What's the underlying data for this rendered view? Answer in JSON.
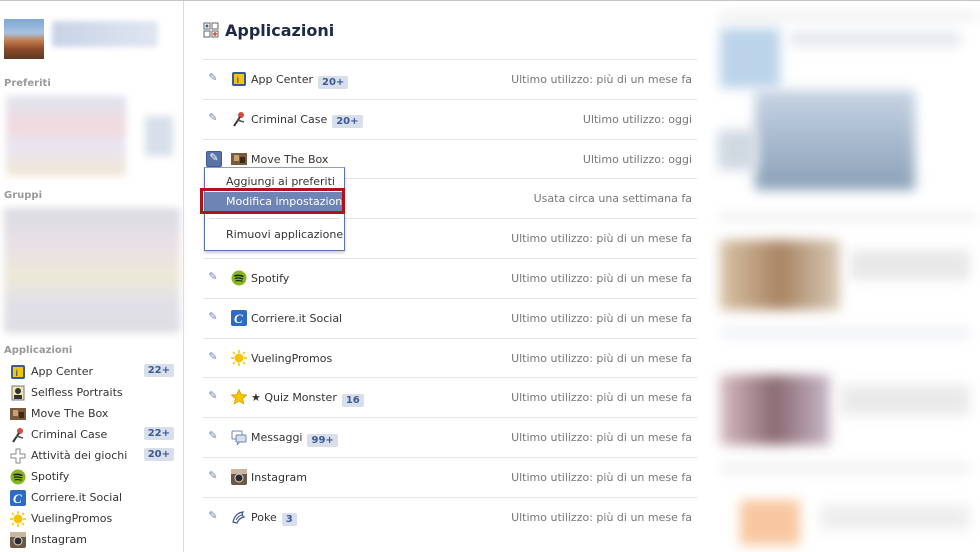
{
  "header": {
    "title": "Applicazioni"
  },
  "sidebar": {
    "sections": {
      "favorites": "Preferiti",
      "groups": "Gruppi",
      "apps": "Applicazioni"
    },
    "apps": [
      {
        "label": "App Center",
        "badge": "22+",
        "icon": "app-center-icon"
      },
      {
        "label": "Selfless Portraits",
        "badge": "",
        "icon": "portrait-icon"
      },
      {
        "label": "Move The Box",
        "badge": "",
        "icon": "move-the-box-icon"
      },
      {
        "label": "Criminal Case",
        "badge": "22+",
        "icon": "criminal-case-icon"
      },
      {
        "label": "Attività dei giochi",
        "badge": "20+",
        "icon": "games-activity-icon"
      },
      {
        "label": "Spotify",
        "badge": "",
        "icon": "spotify-icon"
      },
      {
        "label": "Corriere.it Social",
        "badge": "",
        "icon": "corriere-icon"
      },
      {
        "label": "VuelingPromos",
        "badge": "",
        "icon": "vueling-icon"
      },
      {
        "label": "Instagram",
        "badge": "",
        "icon": "instagram-icon"
      }
    ]
  },
  "apps": [
    {
      "name": "App Center",
      "badge": "20+",
      "usage": "Ultimo utilizzo: più di un mese fa",
      "icon": "app-center-icon"
    },
    {
      "name": "Criminal Case",
      "badge": "20+",
      "usage": "Ultimo utilizzo: oggi",
      "icon": "criminal-case-icon"
    },
    {
      "name": "Move The Box",
      "badge": "",
      "usage": "Ultimo utilizzo: oggi",
      "icon": "move-the-box-icon"
    },
    {
      "name": "",
      "badge": "",
      "usage": "Usata circa una settimana fa",
      "icon": ""
    },
    {
      "name": "",
      "badge": "",
      "usage": "Ultimo utilizzo: più di un mese fa",
      "icon": ""
    },
    {
      "name": "Spotify",
      "badge": "",
      "usage": "Ultimo utilizzo: più di un mese fa",
      "icon": "spotify-icon"
    },
    {
      "name": "Corriere.it Social",
      "badge": "",
      "usage": "Ultimo utilizzo: più di un mese fa",
      "icon": "corriere-icon"
    },
    {
      "name": "VuelingPromos",
      "badge": "",
      "usage": "Ultimo utilizzo: più di un mese fa",
      "icon": "vueling-icon"
    },
    {
      "name": "★ Quiz Monster",
      "badge": "16",
      "usage": "Ultimo utilizzo: più di un mese fa",
      "icon": "star-icon"
    },
    {
      "name": "Messaggi",
      "badge": "99+",
      "usage": "Ultimo utilizzo: più di un mese fa",
      "icon": "messages-icon"
    },
    {
      "name": "Instagram",
      "badge": "",
      "usage": "Ultimo utilizzo: più di un mese fa",
      "icon": "instagram-icon"
    },
    {
      "name": "Poke",
      "badge": "3",
      "usage": "Ultimo utilizzo: più di un mese fa",
      "icon": "poke-icon"
    }
  ],
  "menu": {
    "add_favorites": "Aggiungi ai preferiti",
    "edit_settings": "Modifica impostazioni",
    "remove_app": "Rimuovi applicazione"
  },
  "colors": {
    "accent": "#3b5998",
    "highlight": "#6d84b4",
    "badge_bg": "#d8dfea",
    "annotation_red": "#b1111a"
  }
}
